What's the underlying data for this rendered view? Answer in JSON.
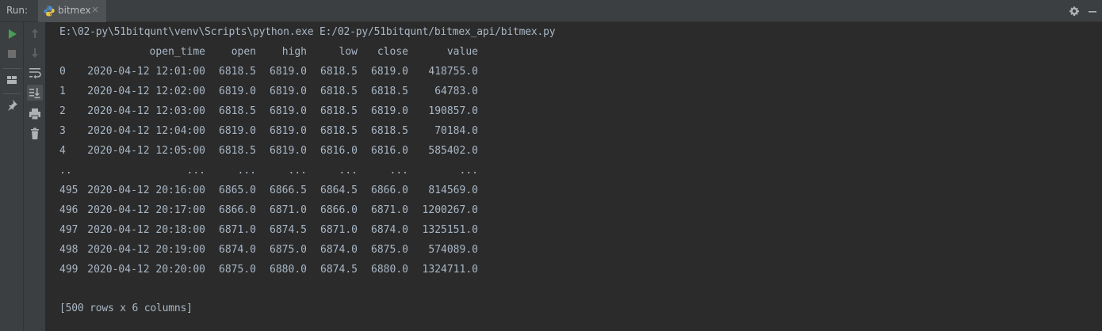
{
  "header": {
    "run_label": "Run:",
    "tab_label": "bitmex",
    "tab_close": "×"
  },
  "toolbar": {
    "left_icons": [
      "run-icon",
      "stop-icon",
      "layout-icon",
      "pin-icon"
    ],
    "right_icons": [
      "up-arrow-icon",
      "down-arrow-icon",
      "soft-wrap-icon",
      "scroll-to-end-icon",
      "print-icon",
      "delete-icon"
    ],
    "run_color": "#499c54",
    "stop_color": "#6e6e6e"
  },
  "console": {
    "command": "E:\\02-py\\51bitqunt\\venv\\Scripts\\python.exe E:/02-py/51bitqunt/bitmex_api/bitmex.py",
    "table": {
      "columns": [
        "open_time",
        "open",
        "high",
        "low",
        "close",
        "value"
      ],
      "rows": [
        {
          "index": "0",
          "open_time": "2020-04-12 12:01:00",
          "open": "6818.5",
          "high": "6819.0",
          "low": "6818.5",
          "close": "6819.0",
          "value": "418755.0"
        },
        {
          "index": "1",
          "open_time": "2020-04-12 12:02:00",
          "open": "6819.0",
          "high": "6819.0",
          "low": "6818.5",
          "close": "6818.5",
          "value": "64783.0"
        },
        {
          "index": "2",
          "open_time": "2020-04-12 12:03:00",
          "open": "6818.5",
          "high": "6819.0",
          "low": "6818.5",
          "close": "6819.0",
          "value": "190857.0"
        },
        {
          "index": "3",
          "open_time": "2020-04-12 12:04:00",
          "open": "6819.0",
          "high": "6819.0",
          "low": "6818.5",
          "close": "6818.5",
          "value": "70184.0"
        },
        {
          "index": "4",
          "open_time": "2020-04-12 12:05:00",
          "open": "6818.5",
          "high": "6819.0",
          "low": "6816.0",
          "close": "6816.0",
          "value": "585402.0"
        },
        {
          "index": "..",
          "open_time": "...",
          "open": "...",
          "high": "...",
          "low": "...",
          "close": "...",
          "value": "..."
        },
        {
          "index": "495",
          "open_time": "2020-04-12 20:16:00",
          "open": "6865.0",
          "high": "6866.5",
          "low": "6864.5",
          "close": "6866.0",
          "value": "814569.0"
        },
        {
          "index": "496",
          "open_time": "2020-04-12 20:17:00",
          "open": "6866.0",
          "high": "6871.0",
          "low": "6866.0",
          "close": "6871.0",
          "value": "1200267.0"
        },
        {
          "index": "497",
          "open_time": "2020-04-12 20:18:00",
          "open": "6871.0",
          "high": "6874.5",
          "low": "6871.0",
          "close": "6874.0",
          "value": "1325151.0"
        },
        {
          "index": "498",
          "open_time": "2020-04-12 20:19:00",
          "open": "6874.0",
          "high": "6875.0",
          "low": "6874.0",
          "close": "6875.0",
          "value": "574089.0"
        },
        {
          "index": "499",
          "open_time": "2020-04-12 20:20:00",
          "open": "6875.0",
          "high": "6880.0",
          "low": "6874.5",
          "close": "6880.0",
          "value": "1324711.0"
        }
      ]
    },
    "summary": "[500 rows x 6 columns]"
  }
}
